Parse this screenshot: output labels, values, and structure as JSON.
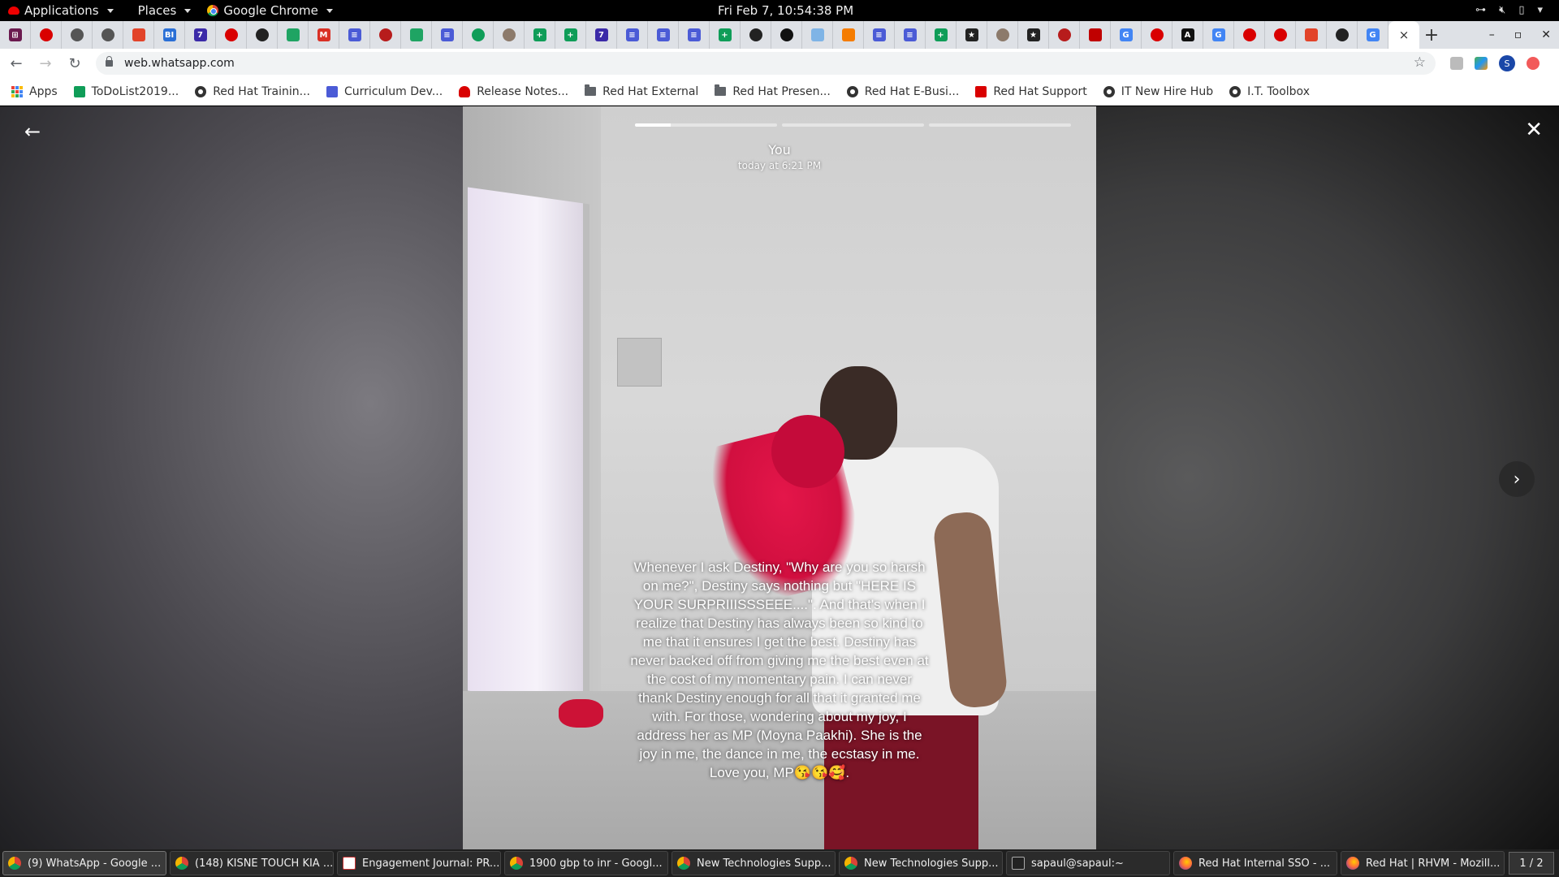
{
  "topbar": {
    "applications": "Applications",
    "places": "Places",
    "browser": "Google Chrome",
    "clock": "Fri Feb  7, 10:54:38 PM"
  },
  "tabs": {
    "pinned_favicons": [
      {
        "icon": "plus-grid-icon",
        "color": "#6b1a4f",
        "glyph": "⊞"
      },
      {
        "icon": "redhat-icon",
        "color": "#d90000",
        "glyph": ""
      },
      {
        "icon": "globe-icon",
        "color": "#555555",
        "glyph": ""
      },
      {
        "icon": "globe-icon",
        "color": "#555555",
        "glyph": ""
      },
      {
        "icon": "gitlab-icon",
        "color": "#e24329",
        "glyph": ""
      },
      {
        "icon": "bi-icon",
        "color": "#2a6fd6",
        "glyph": "BI"
      },
      {
        "icon": "calendar-icon",
        "color": "#3b2aa8",
        "glyph": "7"
      },
      {
        "icon": "redhat-icon",
        "color": "#d90000",
        "glyph": ""
      },
      {
        "icon": "globe-icon",
        "color": "#222222",
        "glyph": ""
      },
      {
        "icon": "drive-icon",
        "color": "#1fa463",
        "glyph": ""
      },
      {
        "icon": "gmail-icon",
        "color": "#d93025",
        "glyph": "M"
      },
      {
        "icon": "docs-icon",
        "color": "#4b5bd6",
        "glyph": "≡"
      },
      {
        "icon": "bug-icon",
        "color": "#b71c1c",
        "glyph": ""
      },
      {
        "icon": "drive-icon",
        "color": "#1fa463",
        "glyph": ""
      },
      {
        "icon": "docs-icon",
        "color": "#4b5bd6",
        "glyph": "≡"
      },
      {
        "icon": "hangouts-icon",
        "color": "#0f9d58",
        "glyph": ""
      },
      {
        "icon": "avatar-icon",
        "color": "#8c7a6b",
        "glyph": ""
      },
      {
        "icon": "sheets-icon",
        "color": "#0f9d58",
        "glyph": "+"
      },
      {
        "icon": "sheets-icon",
        "color": "#0f9d58",
        "glyph": "+"
      },
      {
        "icon": "calendar-icon",
        "color": "#3b2aa8",
        "glyph": "7"
      },
      {
        "icon": "docs-icon",
        "color": "#4b5bd6",
        "glyph": "≡"
      },
      {
        "icon": "docs-icon",
        "color": "#4b5bd6",
        "glyph": "≡"
      },
      {
        "icon": "docs-icon",
        "color": "#4b5bd6",
        "glyph": "≡"
      },
      {
        "icon": "sheets-icon",
        "color": "#0f9d58",
        "glyph": "+"
      },
      {
        "icon": "globe-icon",
        "color": "#222222",
        "glyph": ""
      },
      {
        "icon": "github-icon",
        "color": "#111111",
        "glyph": ""
      },
      {
        "icon": "cloud-icon",
        "color": "#7fb4e6",
        "glyph": ""
      },
      {
        "icon": "box-icon",
        "color": "#f57c00",
        "glyph": ""
      },
      {
        "icon": "docs-icon",
        "color": "#4b5bd6",
        "glyph": "≡"
      },
      {
        "icon": "docs-icon",
        "color": "#4b5bd6",
        "glyph": "≡"
      },
      {
        "icon": "sheets-icon",
        "color": "#0f9d58",
        "glyph": "+"
      },
      {
        "icon": "star-icon",
        "color": "#222222",
        "glyph": "★"
      },
      {
        "icon": "avatar-icon",
        "color": "#8c7a6b",
        "glyph": ""
      },
      {
        "icon": "star-icon",
        "color": "#222222",
        "glyph": "★"
      },
      {
        "icon": "bug-icon",
        "color": "#b71c1c",
        "glyph": ""
      },
      {
        "icon": "shield-icon",
        "color": "#c00000",
        "glyph": ""
      },
      {
        "icon": "google-icon",
        "color": "#4285f4",
        "glyph": "G"
      },
      {
        "icon": "redhat-icon",
        "color": "#d90000",
        "glyph": ""
      },
      {
        "icon": "a-icon",
        "color": "#111111",
        "glyph": "A"
      },
      {
        "icon": "google-icon",
        "color": "#4285f4",
        "glyph": "G"
      },
      {
        "icon": "redhat-icon",
        "color": "#d90000",
        "glyph": ""
      },
      {
        "icon": "redhat-icon",
        "color": "#d90000",
        "glyph": ""
      },
      {
        "icon": "gitlab-icon",
        "color": "#e24329",
        "glyph": ""
      },
      {
        "icon": "globe-icon",
        "color": "#222222",
        "glyph": ""
      },
      {
        "icon": "google-icon",
        "color": "#4285f4",
        "glyph": "G"
      }
    ],
    "active_close": "×",
    "new_tab": "+"
  },
  "toolbar": {
    "url": "web.whatsapp.com"
  },
  "bookmarks": [
    {
      "label": "Apps",
      "icon": "apps-grid-icon",
      "color": "#4285f4"
    },
    {
      "label": "ToDoList2019...",
      "icon": "sheets-icon",
      "color": "#0f9d58"
    },
    {
      "label": "Red Hat Trainin...",
      "icon": "globe-icon",
      "color": "#333333"
    },
    {
      "label": "Curriculum Dev...",
      "icon": "docs-icon",
      "color": "#4b5bd6"
    },
    {
      "label": "Release Notes...",
      "icon": "redhat-icon",
      "color": "#d90000"
    },
    {
      "label": "Red Hat External",
      "icon": "folder-icon",
      "color": "#5f6368"
    },
    {
      "label": "Red Hat Presen...",
      "icon": "folder-icon",
      "color": "#5f6368"
    },
    {
      "label": "Red Hat E-Busi...",
      "icon": "globe-icon",
      "color": "#333333"
    },
    {
      "label": "Red Hat Support",
      "icon": "redhat-support-icon",
      "color": "#d90000"
    },
    {
      "label": "IT New Hire Hub",
      "icon": "globe-icon",
      "color": "#333333"
    },
    {
      "label": "I.T. Toolbox",
      "icon": "globe-icon",
      "color": "#333333"
    }
  ],
  "story": {
    "author": "You",
    "timestamp": "today at 6:21 PM",
    "progress": [
      0.25,
      0,
      0
    ],
    "caption": "Whenever I ask Destiny, \"Why are you so harsh on me?\", Destiny says nothing but \"HERE IS YOUR SURPRIIISSSEEE....\". And that's when I realize that Destiny has always been so kind to me that it ensures I get the best. Destiny has never backed off from giving me the best even at the cost of my momentary pain. I can never thank Destiny enough for all that it granted me with. For those, wondering about my joy, I address her as MP (Moyna Paakhi). She is the joy in me, the dance in me, the ecstasy in me. Love you, MP😘😘🥰."
  },
  "taskbar": {
    "tasks": [
      {
        "label": "(9) WhatsApp - Google ...",
        "icon": "chrome",
        "active": true
      },
      {
        "label": "(148) KISNE TOUCH KIA ...",
        "icon": "chrome",
        "active": false
      },
      {
        "label": "Engagement Journal: PR...",
        "icon": "doc",
        "active": false
      },
      {
        "label": "1900 gbp to inr - Googl...",
        "icon": "chrome",
        "active": false
      },
      {
        "label": "New Technologies Supp...",
        "icon": "chrome",
        "active": false
      },
      {
        "label": "New Technologies Supp...",
        "icon": "chrome",
        "active": false
      },
      {
        "label": "sapaul@sapaul:~",
        "icon": "term",
        "active": false
      },
      {
        "label": "Red Hat Internal SSO - ...",
        "icon": "ff",
        "active": false
      },
      {
        "label": "Red Hat | RHVM - Mozill...",
        "icon": "ff",
        "active": false
      }
    ],
    "workspace": "1 / 2"
  }
}
